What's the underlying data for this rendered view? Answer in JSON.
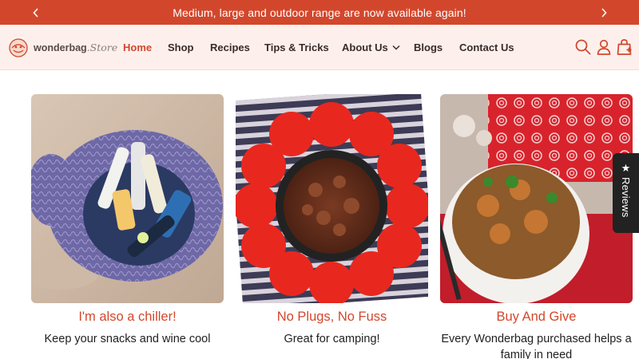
{
  "announcement": {
    "text": "Medium, large and outdoor range are now available again!",
    "prev_icon": "chevron-left-icon",
    "next_icon": "chevron-right-icon"
  },
  "header": {
    "logo_text": "wonderbag",
    "logo_store": ".Store",
    "nav": [
      {
        "label": "Home",
        "active": true
      },
      {
        "label": "Shop"
      },
      {
        "label": "Recipes"
      },
      {
        "label": "Tips & Tricks"
      },
      {
        "label": "About Us",
        "has_dropdown": true
      },
      {
        "label": "Blogs"
      },
      {
        "label": "Contact Us"
      }
    ],
    "icons": [
      "search-icon",
      "account-icon",
      "cart-icon"
    ]
  },
  "cards": [
    {
      "title": "I'm also a chiller!",
      "description": "Keep your snacks and wine cool"
    },
    {
      "title": "No Plugs, No Fuss",
      "description": "Great for camping!"
    },
    {
      "title": "Buy And Give",
      "description": "Every Wonderbag purchased helps a family in need"
    }
  ],
  "reviews_tab": {
    "label": "Reviews",
    "icon": "star-icon"
  },
  "colors": {
    "accent": "#d2472c",
    "header_bg": "#fdf0ec",
    "text": "#3a2a2a"
  }
}
